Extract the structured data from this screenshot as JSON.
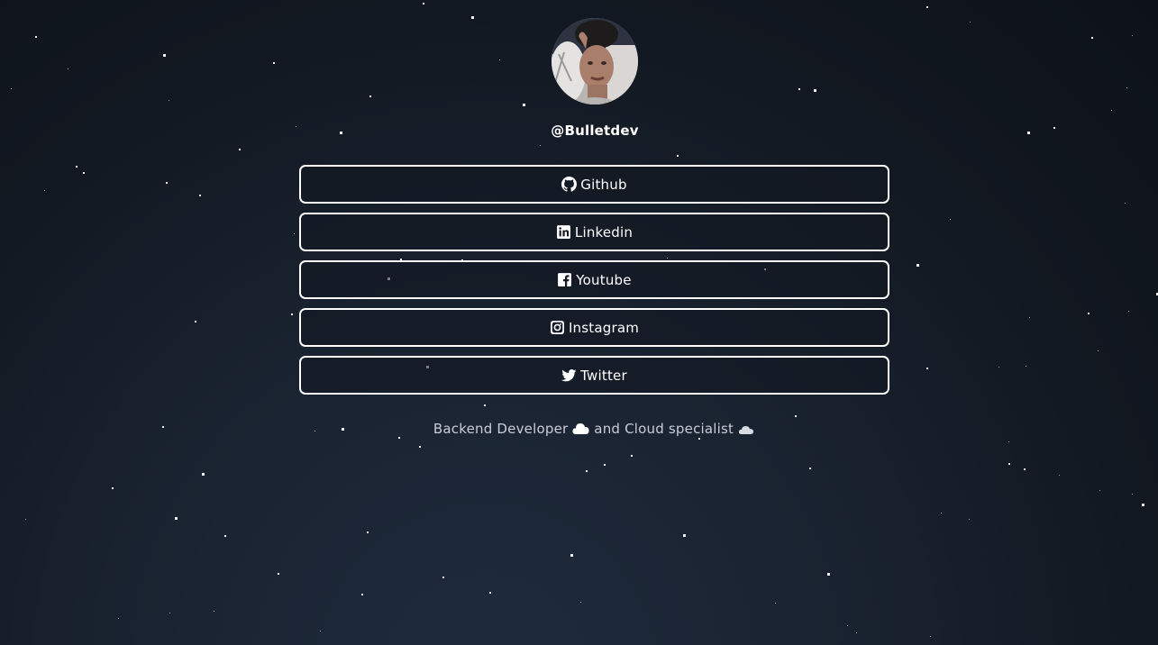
{
  "profile": {
    "handle": "@Bulletdev",
    "avatar_alt": "profile photo"
  },
  "links": [
    {
      "label": "Github",
      "icon": "github-icon"
    },
    {
      "label": "Linkedin",
      "icon": "linkedin-icon"
    },
    {
      "label": "Youtube",
      "icon": "facebook-icon"
    },
    {
      "label": "Instagram",
      "icon": "instagram-icon"
    },
    {
      "label": "Twitter",
      "icon": "twitter-icon"
    }
  ],
  "tagline": {
    "part1": "Backend Developer",
    "part2": "and Cloud specialist",
    "emoji1": "cloud-emoji-white",
    "emoji2": "cloud-emoji-gray"
  },
  "colors": {
    "background_top": "#0d1219",
    "background_bottom": "#1f2b3d",
    "button_border": "#ffffff",
    "text": "#ffffff",
    "tagline_text": "#c9ced6"
  }
}
